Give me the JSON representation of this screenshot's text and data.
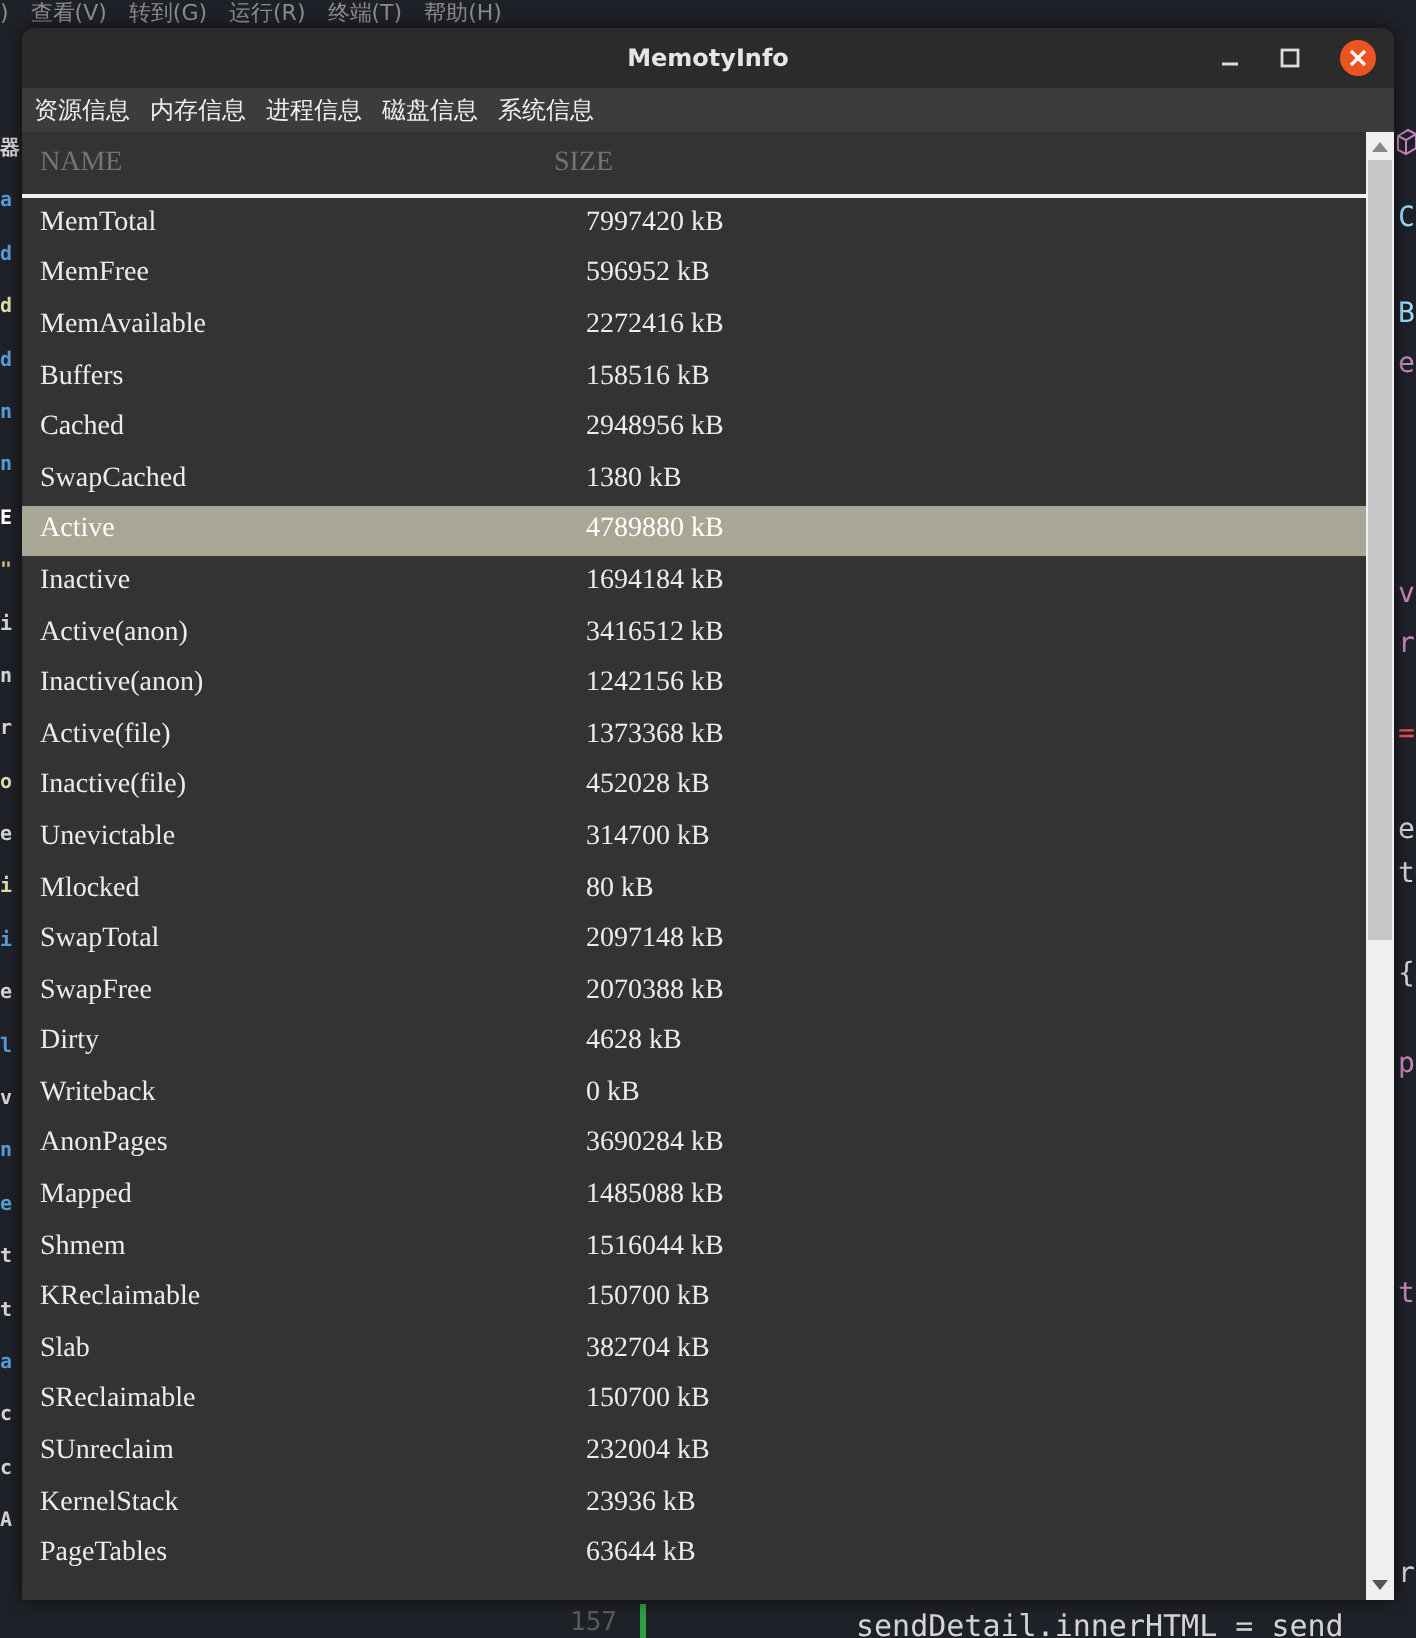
{
  "editor_menu": [
    ")",
    "查看(V)",
    "转到(G)",
    "运行(R)",
    "终端(T)",
    "帮助(H)"
  ],
  "editor_left_fragments": [
    {
      "text": "器",
      "color": "#d4d4d4"
    },
    {
      "text": "a",
      "color": "#569cd6"
    },
    {
      "text": "d",
      "color": "#569cd6"
    },
    {
      "text": "d",
      "color": "#dcdcaa"
    },
    {
      "text": "d",
      "color": "#569cd6"
    },
    {
      "text": "n",
      "color": "#569cd6"
    },
    {
      "text": "n",
      "color": "#569cd6"
    },
    {
      "text": "E",
      "color": "#ffffff"
    },
    {
      "text": "\"",
      "color": "#d7ba7d"
    },
    {
      "text": "i",
      "color": "#d4d4d4"
    },
    {
      "text": "n",
      "color": "#d4d4d4"
    },
    {
      "text": "r",
      "color": "#d4d4d4"
    },
    {
      "text": "o",
      "color": "#dcdcaa"
    },
    {
      "text": "e",
      "color": "#d4d4d4"
    },
    {
      "text": "i",
      "color": "#dcdcaa"
    },
    {
      "text": "i",
      "color": "#569cd6"
    },
    {
      "text": "e",
      "color": "#d4d4d4"
    },
    {
      "text": "l",
      "color": "#569cd6"
    },
    {
      "text": "v",
      "color": "#d4d4d4"
    },
    {
      "text": "n",
      "color": "#569cd6"
    },
    {
      "text": "e",
      "color": "#569cd6"
    },
    {
      "text": "t",
      "color": "#d4d4d4"
    },
    {
      "text": "t",
      "color": "#d4d4d4"
    },
    {
      "text": "a",
      "color": "#569cd6"
    },
    {
      "text": "c",
      "color": "#d4d4d4"
    },
    {
      "text": "c",
      "color": "#d4d4d4"
    },
    {
      "text": "A",
      "color": "#d4d4d4"
    }
  ],
  "editor_right_fragments": [
    {
      "text": "C",
      "color": "#9cdcfe"
    },
    {
      "text": "B",
      "color": "#9cdcfe"
    },
    {
      "text": "e",
      "color": "#c586c0"
    },
    {
      "text": "v",
      "color": "#c586c0"
    },
    {
      "text": "r",
      "color": "#c586c0"
    },
    {
      "text": "=",
      "color": "#f14c4c"
    },
    {
      "text": "e",
      "color": "#d4d4d4"
    },
    {
      "text": "t",
      "color": "#d4d4d4"
    },
    {
      "text": "{",
      "color": "#d4d4d4"
    },
    {
      "text": "p",
      "color": "#c586c0"
    },
    {
      "text": "t",
      "color": "#c586c0"
    },
    {
      "text": "r",
      "color": "#d4d4d4"
    }
  ],
  "editor_bottom": {
    "line_number": "157",
    "code": "sendDetail.innerHTML = send"
  },
  "window": {
    "title": "MemotyInfo"
  },
  "menu": [
    "资源信息",
    "内存信息",
    "进程信息",
    "磁盘信息",
    "系统信息"
  ],
  "table": {
    "columns": [
      "NAME",
      "SIZE"
    ],
    "rows": [
      {
        "name": "MemTotal",
        "size": "7997420 kB",
        "selected": false
      },
      {
        "name": "MemFree",
        "size": "596952 kB",
        "selected": false
      },
      {
        "name": "MemAvailable",
        "size": "2272416 kB",
        "selected": false
      },
      {
        "name": "Buffers",
        "size": "158516 kB",
        "selected": false
      },
      {
        "name": "Cached",
        "size": "2948956 kB",
        "selected": false
      },
      {
        "name": "SwapCached",
        "size": "1380 kB",
        "selected": false
      },
      {
        "name": "Active",
        "size": "4789880 kB",
        "selected": true
      },
      {
        "name": "Inactive",
        "size": "1694184 kB",
        "selected": false
      },
      {
        "name": "Active(anon)",
        "size": "3416512 kB",
        "selected": false
      },
      {
        "name": "Inactive(anon)",
        "size": "1242156 kB",
        "selected": false
      },
      {
        "name": "Active(file)",
        "size": "1373368 kB",
        "selected": false
      },
      {
        "name": "Inactive(file)",
        "size": "452028 kB",
        "selected": false
      },
      {
        "name": "Unevictable",
        "size": "314700 kB",
        "selected": false
      },
      {
        "name": "Mlocked",
        "size": "80 kB",
        "selected": false
      },
      {
        "name": "SwapTotal",
        "size": "2097148 kB",
        "selected": false
      },
      {
        "name": "SwapFree",
        "size": "2070388 kB",
        "selected": false
      },
      {
        "name": "Dirty",
        "size": "4628 kB",
        "selected": false
      },
      {
        "name": "Writeback",
        "size": "0 kB",
        "selected": false
      },
      {
        "name": "AnonPages",
        "size": "3690284 kB",
        "selected": false
      },
      {
        "name": "Mapped",
        "size": "1485088 kB",
        "selected": false
      },
      {
        "name": "Shmem",
        "size": "1516044 kB",
        "selected": false
      },
      {
        "name": "KReclaimable",
        "size": "150700 kB",
        "selected": false
      },
      {
        "name": "Slab",
        "size": "382704 kB",
        "selected": false
      },
      {
        "name": "SReclaimable",
        "size": "150700 kB",
        "selected": false
      },
      {
        "name": "SUnreclaim",
        "size": "232004 kB",
        "selected": false
      },
      {
        "name": "KernelStack",
        "size": "23936 kB",
        "selected": false
      },
      {
        "name": "PageTables",
        "size": "63644 kB",
        "selected": false
      }
    ]
  }
}
